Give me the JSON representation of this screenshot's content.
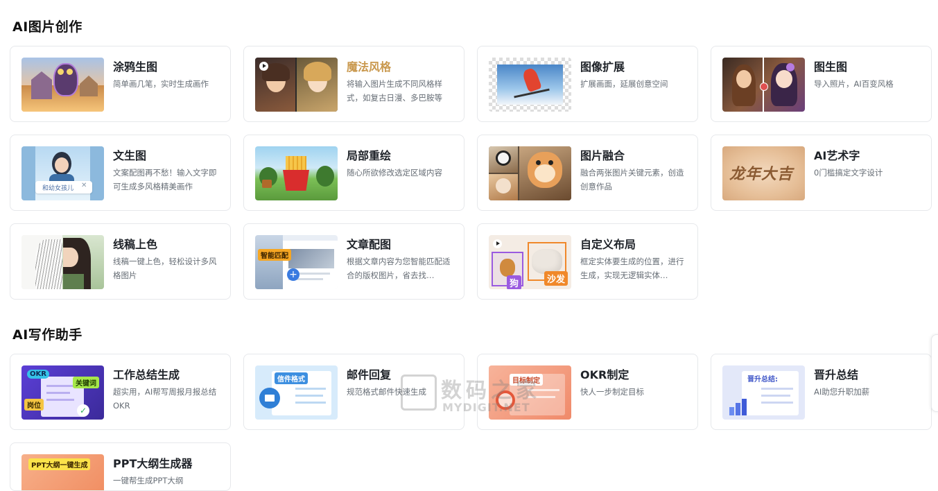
{
  "sections": {
    "image": {
      "title": "AI图片创作",
      "cards": [
        {
          "title": "涂鸦生图",
          "desc": "简单画几笔，实时生成画作"
        },
        {
          "title": "魔法风格",
          "desc": "将输入图片生成不同风格样式，如复古日漫、多巴胺等"
        },
        {
          "title": "图像扩展",
          "desc": "扩展画面，延展创意空间"
        },
        {
          "title": "图生图",
          "desc": "导入照片，AI百变风格"
        },
        {
          "title": "文生图",
          "desc": "文案配图再不愁！输入文字即可生成多风格精美画作"
        },
        {
          "title": "局部重绘",
          "desc": "随心所欲修改选定区域内容"
        },
        {
          "title": "图片融合",
          "desc": "融合两张图片关键元素，创造创意作品"
        },
        {
          "title": "AI艺术字",
          "desc": "0门槛搞定文字设计"
        },
        {
          "title": "线稿上色",
          "desc": "线稿一键上色，轻松设计多风格图片"
        },
        {
          "title": "文章配图",
          "desc": "根据文章内容为您智能匹配适合的版权图片，省去找…"
        },
        {
          "title": "自定义布局",
          "desc": "框定实体要生成的位置，进行生成，实现无逻辑实体…"
        }
      ]
    },
    "writing": {
      "title": "AI写作助手",
      "cards": [
        {
          "title": "工作总结生成",
          "desc": "超实用，AI帮写周报月报总结OKR"
        },
        {
          "title": "邮件回复",
          "desc": "规范格式邮件快速生成"
        },
        {
          "title": "OKR制定",
          "desc": "快人一步制定目标"
        },
        {
          "title": "晋升总结",
          "desc": "AI助您升职加薪"
        },
        {
          "title": "PPT大纲生成器",
          "desc": "一键帮生成PPT大纲"
        }
      ]
    }
  },
  "thumb_text": {
    "input_tag": "和幼女孩儿",
    "match_tag": "智能匹配",
    "dog_tag": "狗",
    "sofa_tag": "沙发",
    "okr_tag": "OKR",
    "keyword_tag": "关键词",
    "position_tag": "岗位",
    "mail_tag": "信件格式",
    "goal_tag": "目标制定",
    "promo_tag": "晋升总结:",
    "ppt_tag": "PPT大纲一键生成",
    "art_text": "龙年大吉"
  },
  "watermark": {
    "cn": "数码之家",
    "en": "MYDIGIT.NET"
  },
  "colors": {
    "highlight_title": "#c9984d",
    "card_border": "#e6e8eb",
    "desc_text": "#666d75"
  }
}
